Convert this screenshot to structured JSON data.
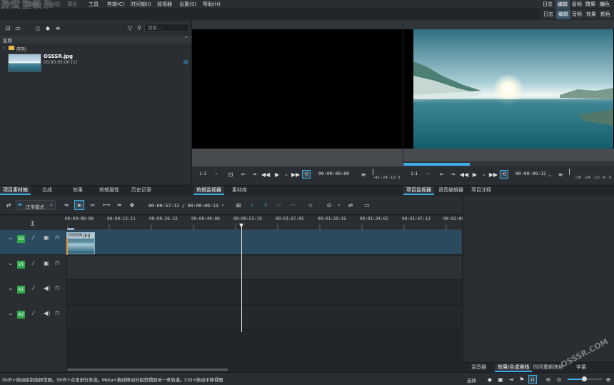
{
  "watermark_title": "吾爱重装系",
  "menu": {
    "items": [
      "文件",
      "编辑",
      "视图",
      "项目",
      "工具",
      "剪辑(C)",
      "时间轴(I)",
      "监视器",
      "设置(S)",
      "帮助(H)"
    ],
    "layouts": [
      "日志",
      "编辑",
      "音频",
      "效果",
      "颜色"
    ]
  },
  "bin": {
    "search_placeholder": "搜索...",
    "column_name": "名称",
    "folder_label": "序列",
    "clip_name": "OSSSR.jpg",
    "clip_duration": "00:00:05:00 [1]"
  },
  "left_tabs": [
    "项目素材箱",
    "合成",
    "效果",
    "剪辑属性",
    "历史记录"
  ],
  "clip_monitor": {
    "zoom": "1:1",
    "timecode": "00:00:00:00",
    "vu": [
      "-42",
      "-24",
      "-12",
      "0"
    ],
    "tabs": [
      "剪辑监视器",
      "素材库"
    ]
  },
  "project_monitor": {
    "zoom": "1:1",
    "timecode": "00:00:09:12",
    "vu": [
      "-36",
      "-24",
      "-12",
      "-6",
      "0"
    ],
    "tabs": [
      "项目监视器",
      "语音编辑器",
      "项目注释"
    ]
  },
  "timeline_toolbar": {
    "mode": "正常模式",
    "position": "00:00:57:12 / 00:00:09:13"
  },
  "timeline": {
    "master_label": "主",
    "ruler": [
      "00:00:00:00",
      "00:00:13:11",
      "00:00:26:22",
      "00:00:40:08",
      "00:00:53:19",
      "00:01:07:05",
      "00:01:20:16",
      "00:01:34:02",
      "00:01:47:13",
      "00:02:00"
    ],
    "tracks": [
      {
        "tag": "V2",
        "kind": "video"
      },
      {
        "tag": "V1",
        "kind": "video"
      },
      {
        "tag": "A1",
        "kind": "audio"
      },
      {
        "tag": "A2",
        "kind": "audio"
      }
    ],
    "clip_label": "OSSSR.jpg"
  },
  "right_bottom_tabs": [
    "混音器",
    "效果/合成堆栈",
    "时间重新映射",
    "字幕"
  ],
  "status": {
    "hint": "Shift+拖动绘制选择范围。Shift+点击进行多选。Meta+拖动移动分组剪辑到另一条轨道。Ctrl+拖动平移视图",
    "select_label": "选择"
  },
  "watermark_corner": "OSSSR.COM",
  "colors": {
    "accent": "#3daee9",
    "track_tag": "#2ea84a",
    "selected_track": "#2b4a5e"
  }
}
